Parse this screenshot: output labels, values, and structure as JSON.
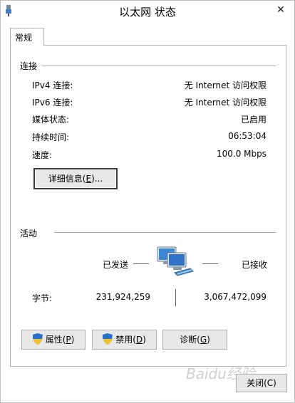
{
  "window": {
    "title": "以太网 状态",
    "close_glyph": "✕"
  },
  "tabs": [
    {
      "label": "常规"
    }
  ],
  "connection": {
    "section_title": "连接",
    "rows": [
      {
        "label": "IPv4 连接:",
        "value": "无 Internet 访问权限"
      },
      {
        "label": "IPv6 连接:",
        "value": "无 Internet 访问权限"
      },
      {
        "label": "媒体状态:",
        "value": "已启用"
      },
      {
        "label": "持续时间:",
        "value": "06:53:04"
      },
      {
        "label": "速度:",
        "value": "100.0 Mbps"
      }
    ],
    "details_button": {
      "pre": "详细信息(",
      "key": "E",
      "post": ")..."
    }
  },
  "activity": {
    "section_title": "活动",
    "sent_label": "已发送",
    "received_label": "已接收",
    "bytes_label": "字节:",
    "bytes_sent": "231,924,259",
    "bytes_received": "3,067,472,099"
  },
  "buttons": {
    "properties": {
      "pre": "属性(",
      "key": "P",
      "post": ")"
    },
    "disable": {
      "pre": "禁用(",
      "key": "D",
      "post": ")"
    },
    "diagnose": {
      "pre": "诊断(",
      "key": "G",
      "post": ")"
    }
  },
  "footer": {
    "close_label": "关闭(C)"
  },
  "watermark": "Baidu经验",
  "icons": {
    "title_icon": "network-adapter-icon",
    "shield": "uac-shield-icon",
    "network": "network-computers-icon"
  },
  "colors": {
    "accent": "#2a6fc9",
    "button_bg": "#e8e8e8",
    "border": "#b4b4b4"
  }
}
